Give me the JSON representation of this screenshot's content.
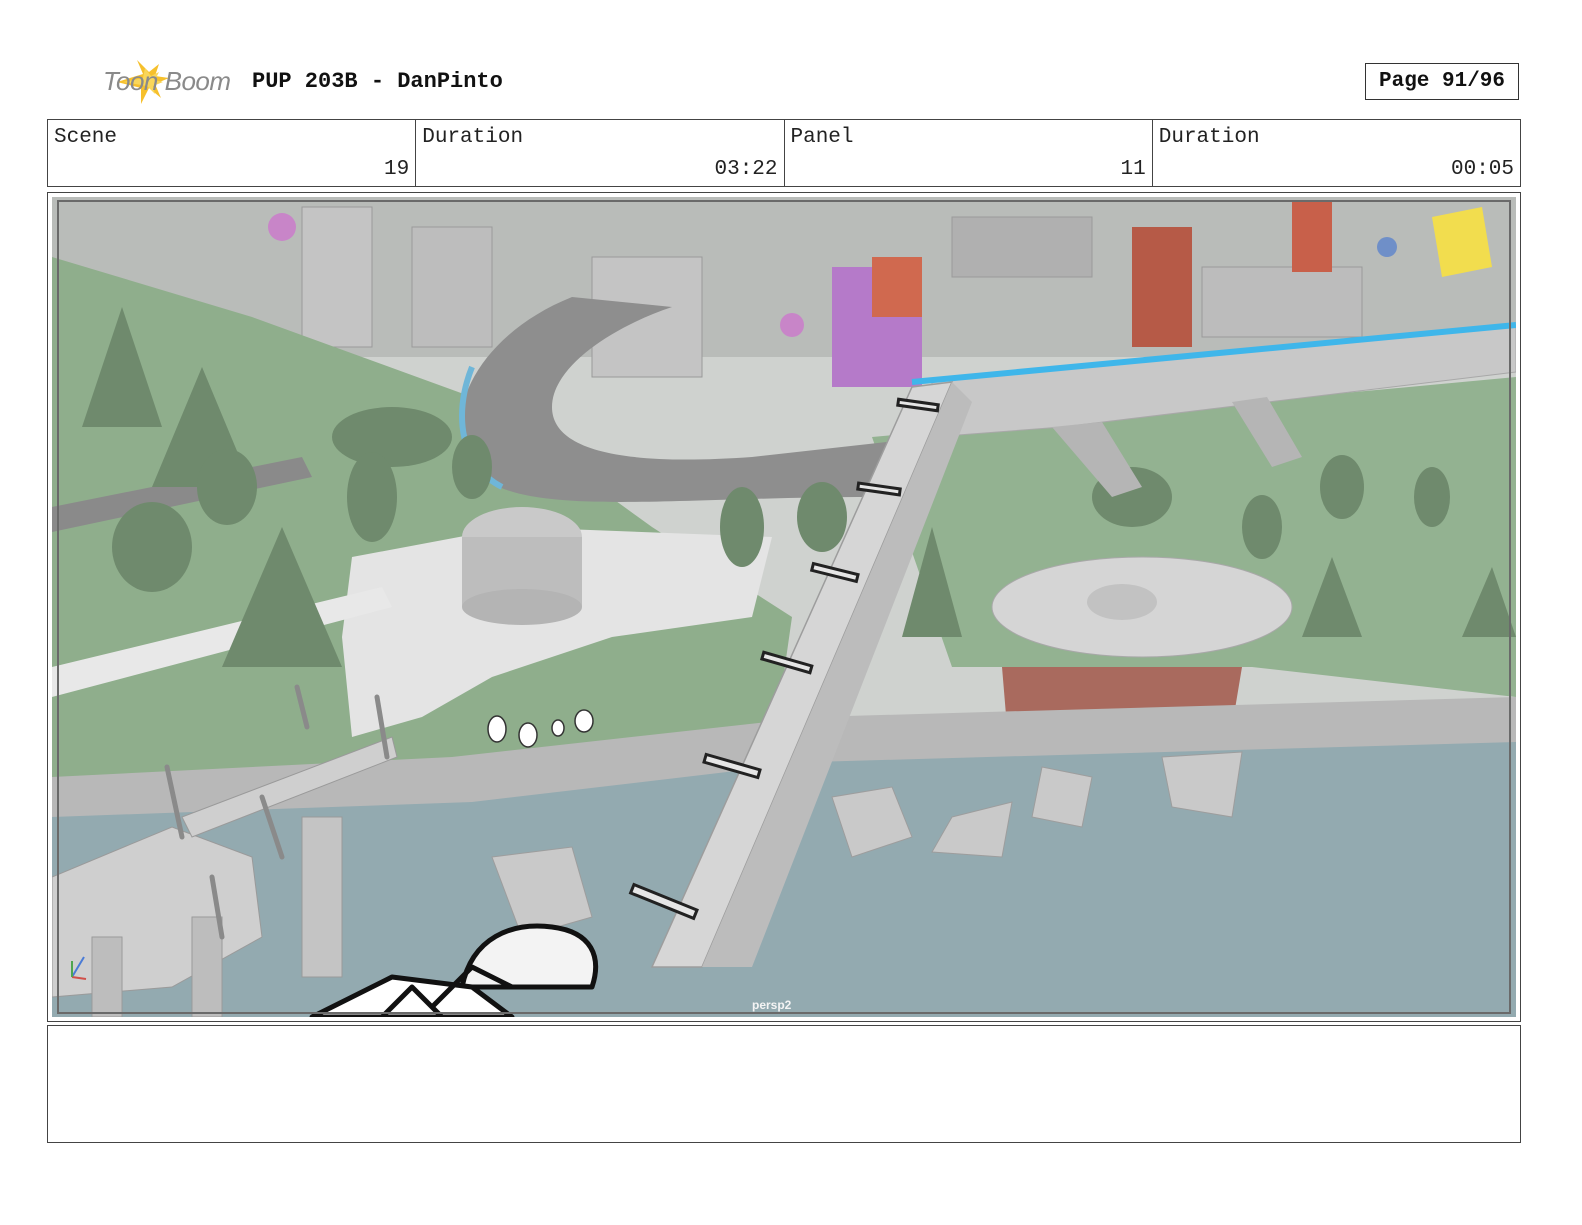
{
  "header": {
    "logo_text": "Toon Boom",
    "title": "PUP 203B - DanPinto",
    "page": "Page 91/96"
  },
  "info": {
    "scene_label": "Scene",
    "scene_value": "19",
    "scene_duration_label": "Duration",
    "scene_duration_value": "03:22",
    "panel_label": "Panel",
    "panel_value": "11",
    "panel_duration_label": "Duration",
    "panel_duration_value": "00:05"
  },
  "viewport": {
    "camera_label": "persp2"
  },
  "notes": {
    "text": ""
  },
  "colors": {
    "grass": "#8fae8c",
    "water": "#93aab0",
    "road": "#8e8e8e",
    "stone": "#d2d2d2",
    "accent_blue": "#3fb6ea",
    "logo_yellow": "#f6c02c"
  }
}
